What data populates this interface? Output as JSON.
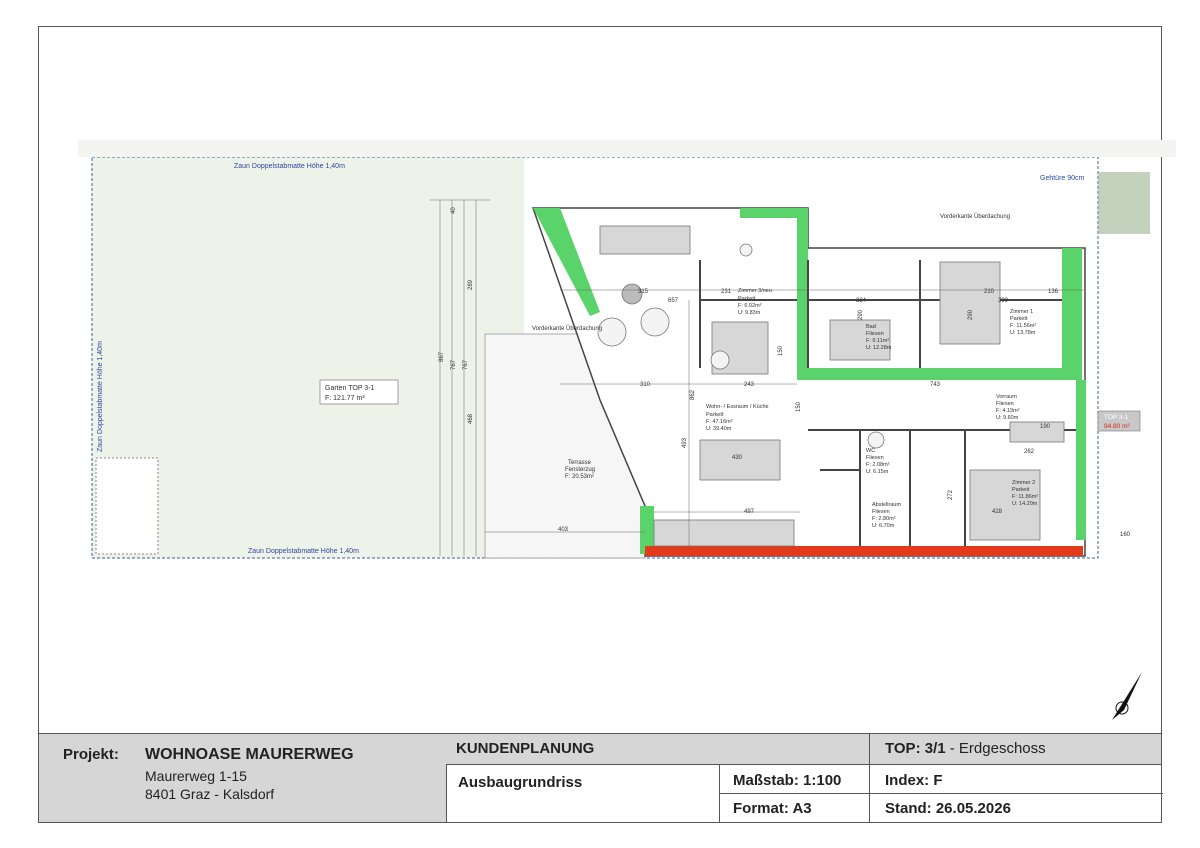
{
  "plan": {
    "garden_fence_top": "Zaun Doppelstabmatte Höhe 1,40m",
    "garden_fence_left": "Zaun Doppelstabmatte Höhe 1,40m",
    "garden_fence_bottom": "Zaun Doppelstabmatte Höhe 1,40m",
    "garden_label": "Garten TOP 3-1",
    "garden_area": "F: 121.77 m²",
    "terrace_label": "Terrasse",
    "terrace_sub": "Fensterzug",
    "terrace_area": "F: 20.53m²",
    "vorderkante_left": "Vorderkante Überdachung",
    "vorderkante_top": "Vorderkante Überdachung",
    "gehtuere": "Gehtüre 90cm",
    "top_label": "TOP 3-1",
    "top_area": "94.80 m²",
    "rooms": [
      {
        "name": "Zimmer 3/neu",
        "floor": "Parkett",
        "f": "F: 6.02m²",
        "u": "U: 9.83m"
      },
      {
        "name": "Wohn- / Essraum / Küche",
        "floor": "Parkett",
        "f": "F: 47.16m²",
        "u": "U: 39.40m"
      },
      {
        "name": "Bad",
        "floor": "Fliesen",
        "f": "F: 9.11m²",
        "u": "U: 12.28m"
      },
      {
        "name": "Zimmer 1",
        "floor": "Parkett",
        "f": "F: 11.56m²",
        "u": "U: 13.78m"
      },
      {
        "name": "Vorraum",
        "floor": "Fliesen",
        "f": "F: 4.19m²",
        "u": "U: 9.60m"
      },
      {
        "name": "WC",
        "floor": "Fliesen",
        "f": "F: 2.08m²",
        "u": "U: 6.15m"
      },
      {
        "name": "Abstellraum",
        "floor": "Fliesen",
        "f": "F: 2.80m²",
        "u": "U: 6.70m"
      },
      {
        "name": "Zimmer 2",
        "floor": "Parkett",
        "f": "F: 11.86m²",
        "u": "U: 14.20m"
      }
    ],
    "dims": [
      "315",
      "657",
      "231",
      "324",
      "399",
      "210",
      "136",
      "310",
      "243",
      "743",
      "497",
      "430",
      "403",
      "428",
      "262",
      "190",
      "160",
      "867",
      "767",
      "767",
      "468",
      "289",
      "40",
      "862",
      "493",
      "290",
      "290",
      "150",
      "150",
      "272"
    ]
  },
  "titleblock": {
    "project_label": "Projekt:",
    "project_name": "WOHNOASE MAURERWEG",
    "address_line1": "Maurerweg 1-15",
    "address_line2": "8401 Graz - Kalsdorf",
    "planning": "KUNDENPLANUNG",
    "top_label": "TOP:",
    "top_value": "3/1",
    "top_floor": "- Erdgeschoss",
    "plan_type": "Ausbaugrundriss",
    "scale_label": "Maßstab:",
    "scale_value": "1:100",
    "index_label": "Index:",
    "index_value": "F",
    "format_label": "Format:",
    "format_value": "A3",
    "date_label": "Stand:",
    "date_value": "26.05.2026"
  }
}
